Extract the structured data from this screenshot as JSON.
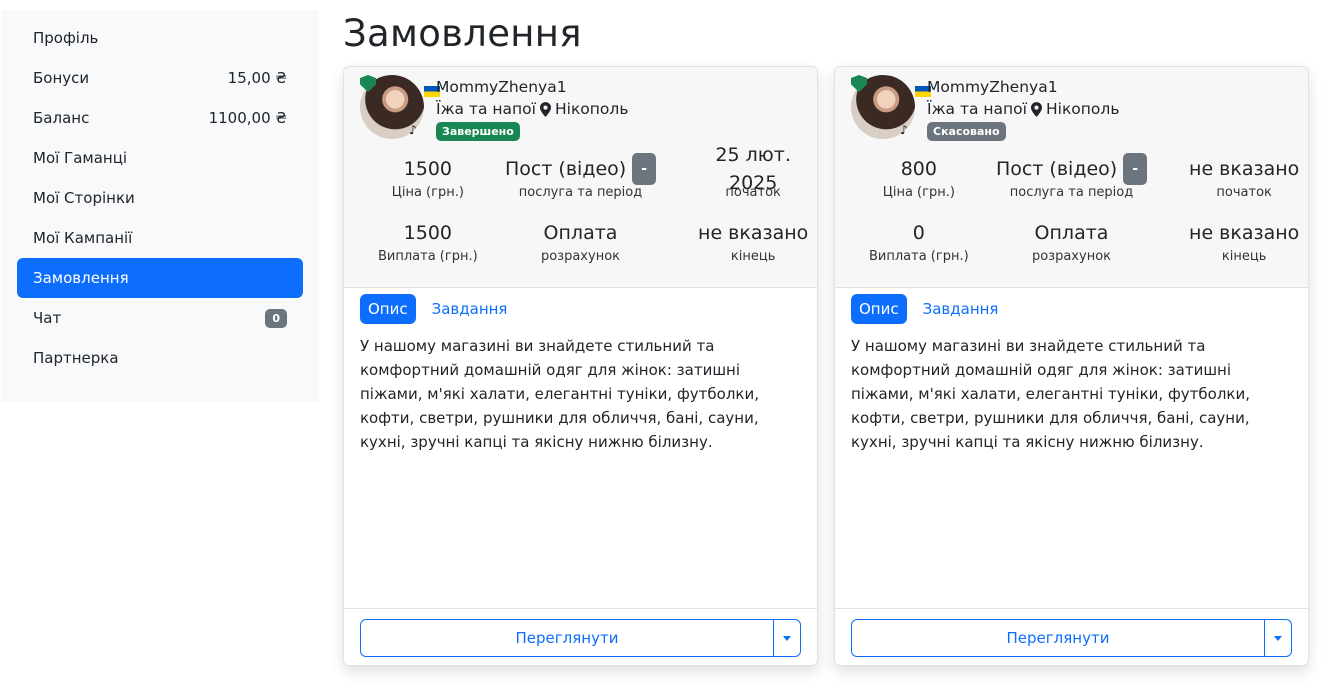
{
  "sidebar": {
    "items": [
      {
        "label": "Профіль",
        "value": ""
      },
      {
        "label": "Бонуси",
        "value": "15,00 ₴"
      },
      {
        "label": "Баланс",
        "value": "1100,00 ₴"
      },
      {
        "label": "Мої Гаманці",
        "value": ""
      },
      {
        "label": "Мої Сторінки",
        "value": ""
      },
      {
        "label": "Мої Кампанії",
        "value": ""
      },
      {
        "label": "Замовлення",
        "value": ""
      },
      {
        "label": "Чат",
        "badge": "0"
      },
      {
        "label": "Партнерка",
        "value": ""
      }
    ]
  },
  "page": {
    "title": "Замовлення"
  },
  "colors": {
    "accent": "#0d6efd",
    "completed": "#198754",
    "cancelled": "#6c757d"
  },
  "orders": [
    {
      "username": "MommyZhenya1",
      "category": "Їжа та напої",
      "city": "Нікополь",
      "status": "Завершено",
      "price": "1500",
      "price_label": "Ціна (грн.)",
      "service": "Пост (відео)",
      "service_btn": "-",
      "service_label": "послуга та період",
      "start": "25 лют. 2025",
      "start_label": "початок",
      "payout": "1500",
      "payout_label": "Виплата (грн.)",
      "settlement": "Оплата",
      "settlement_label": "розрахунок",
      "end": "не вказано",
      "end_label": "кінець",
      "tab_desc": "Опис",
      "tab_tasks": "Завдання",
      "description": "У нашому магазині ви знайдете стильний та комфортний домашній одяг для жінок: затишні піжами, м'які халати, елегантні туніки, футболки, кофти, светри, рушники для обличчя, бані, сауни, кухні, зручні капці та якісну нижню білизну.",
      "view_label": "Переглянути"
    },
    {
      "username": "MommyZhenya1",
      "category": "Їжа та напої",
      "city": "Нікополь",
      "status": "Скасовано",
      "price": "800",
      "price_label": "Ціна (грн.)",
      "service": "Пост (відео)",
      "service_btn": "-",
      "service_label": "послуга та період",
      "start": "не вказано",
      "start_label": "початок",
      "payout": "0",
      "payout_label": "Виплата (грн.)",
      "settlement": "Оплата",
      "settlement_label": "розрахунок",
      "end": "не вказано",
      "end_label": "кінець",
      "tab_desc": "Опис",
      "tab_tasks": "Завдання",
      "description": "У нашому магазині ви знайдете стильний та комфортний домашній одяг для жінок: затишні піжами, м'які халати, елегантні туніки, футболки, кофти, светри, рушники для обличчя, бані, сауни, кухні, зручні капці та якісну нижню білизну.",
      "view_label": "Переглянути"
    }
  ]
}
